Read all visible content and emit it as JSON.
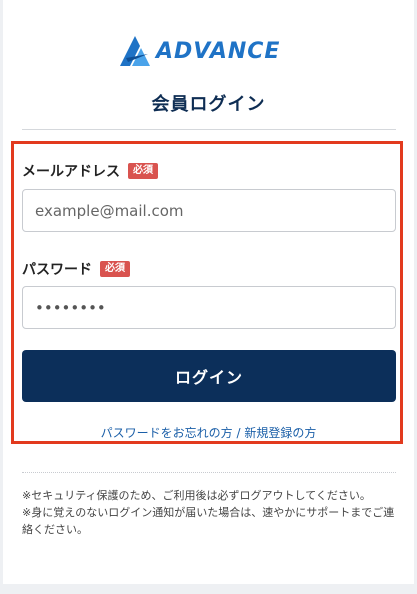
{
  "brand": {
    "logo_text": "ADVANCE",
    "accent": "#1f73c6",
    "primary": "#0c2f5a",
    "required_color": "#d9534f",
    "highlight_color": "#e23a1e"
  },
  "page": {
    "title": "会員ログイン"
  },
  "form": {
    "email": {
      "label": "メールアドレス",
      "required": "必須",
      "placeholder": "example@mail.com",
      "value": ""
    },
    "password": {
      "label": "パスワード",
      "required": "必須",
      "value": "password"
    },
    "submit_label": "ログイン"
  },
  "links": {
    "forgot": "パスワードをお忘れの方",
    "separator": " / ",
    "register": "新規登録の方"
  },
  "notes": [
    "※セキュリティ保護のため、ご利用後は必ずログアウトしてください。",
    "※身に覚えのないログイン通知が届いた場合は、速やかにサポートまでご連絡ください。"
  ]
}
